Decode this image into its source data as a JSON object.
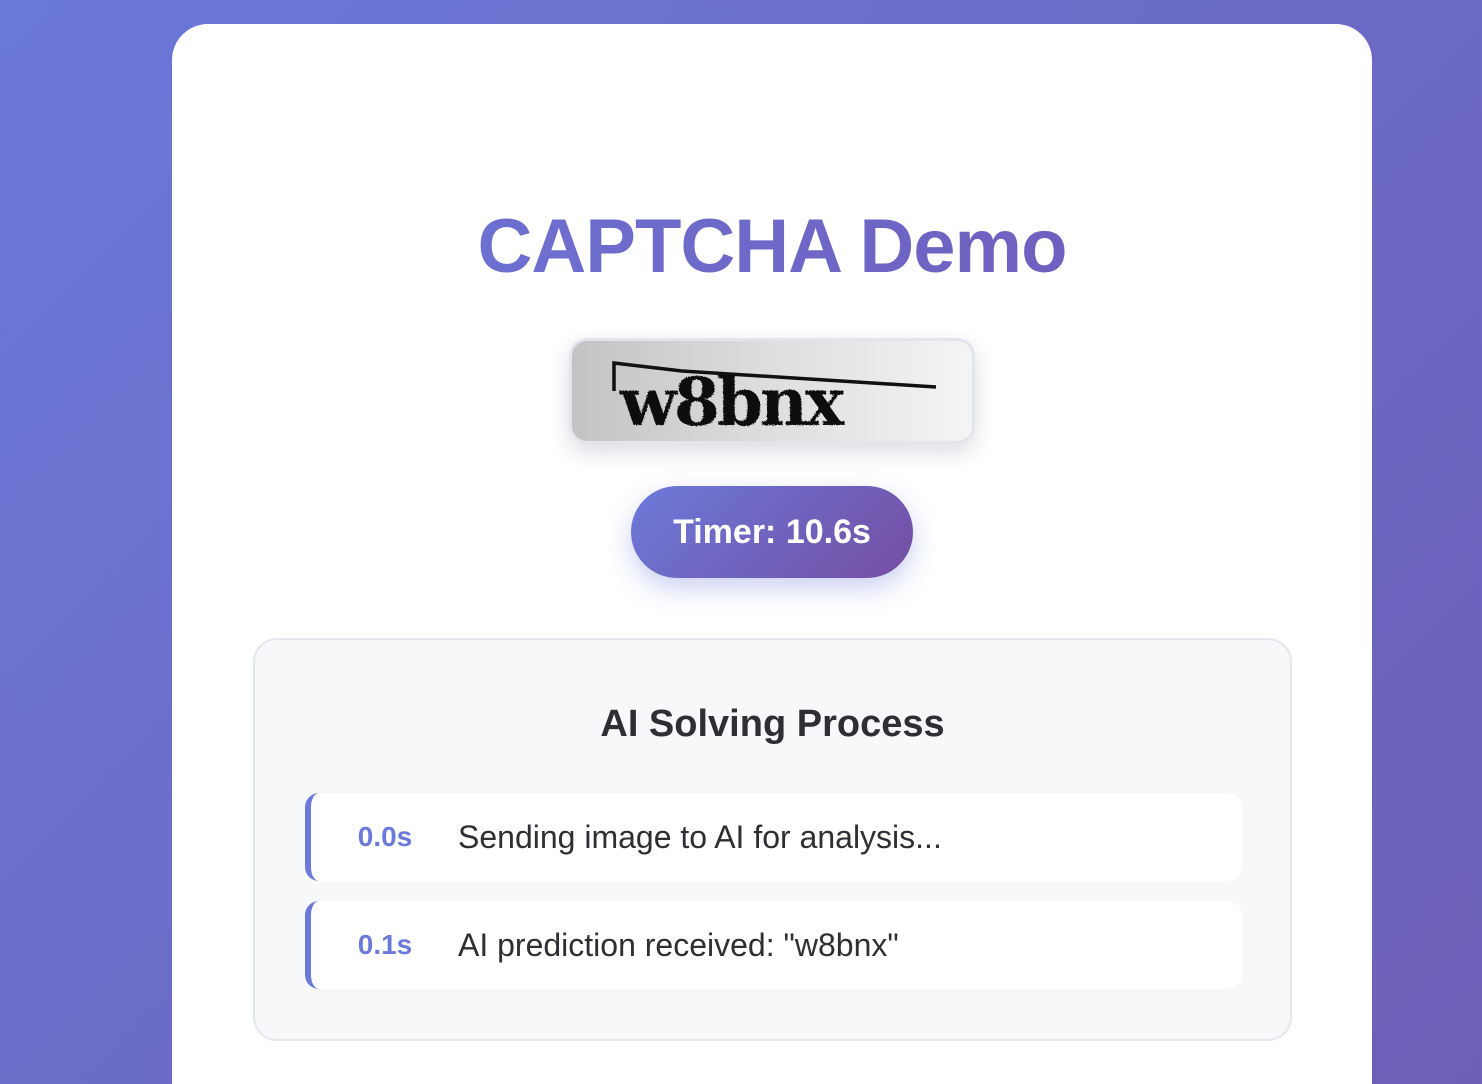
{
  "header": {
    "title": "CAPTCHA Demo"
  },
  "captcha": {
    "text": "w8bnx"
  },
  "timer": {
    "label": "Timer: 10.6s"
  },
  "process": {
    "title": "AI Solving Process",
    "steps": [
      {
        "time": "0.0s",
        "message": "Sending image to AI for analysis..."
      },
      {
        "time": "0.1s",
        "message": "AI prediction received: \"w8bnx\""
      }
    ]
  },
  "colors": {
    "accent": "#6b7ada",
    "accent_dark": "#744ea3",
    "text": "#2d2f33",
    "panel_bg": "#f7f8fa"
  }
}
